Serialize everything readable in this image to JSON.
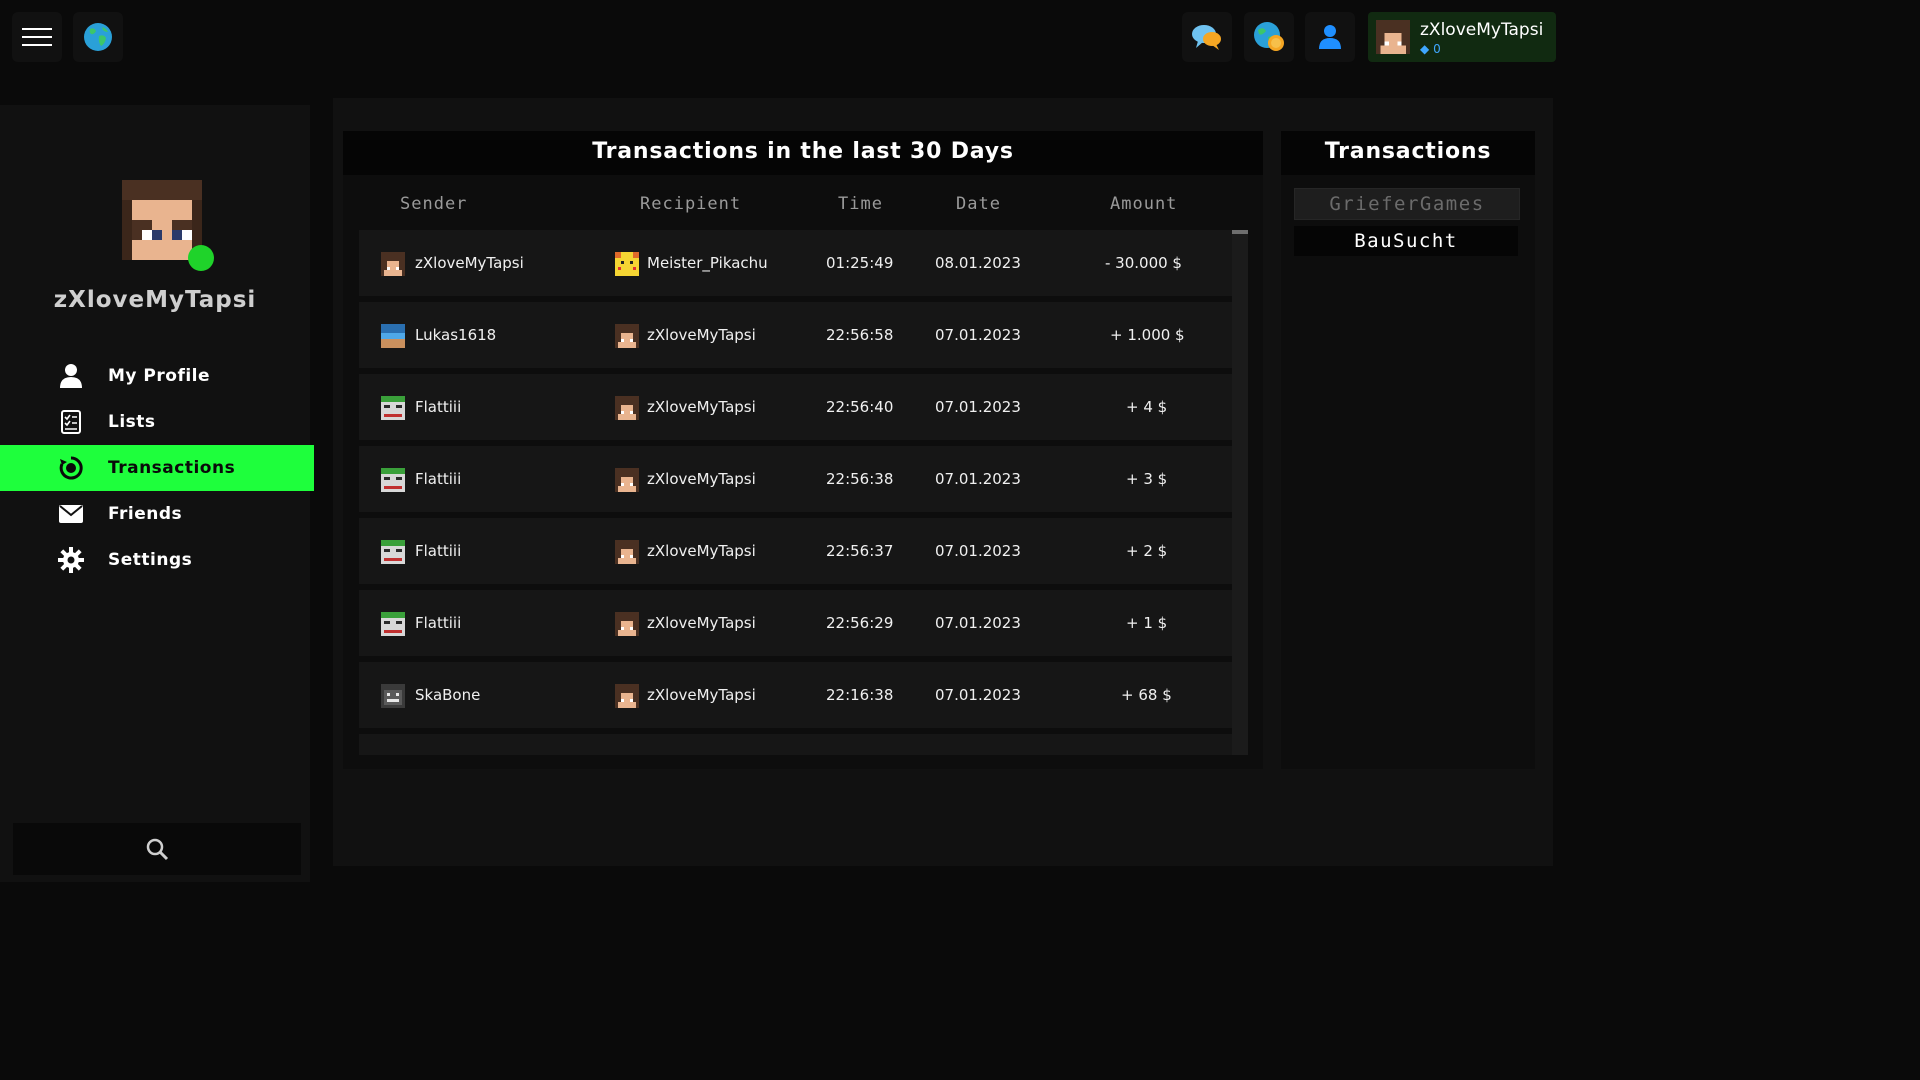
{
  "header": {
    "user_name": "zXloveMyTapsi",
    "gems": "0",
    "icons": [
      "menu-icon",
      "globe-icon",
      "chat-icon",
      "coins-icon",
      "user-icon"
    ]
  },
  "sidebar": {
    "user_name": "zXloveMyTapsi",
    "status": "online",
    "items": [
      {
        "label": "My Profile",
        "icon": "user-icon"
      },
      {
        "label": "Lists",
        "icon": "list-icon"
      },
      {
        "label": "Transactions",
        "icon": "transactions-icon",
        "active": true
      },
      {
        "label": "Friends",
        "icon": "mail-icon"
      },
      {
        "label": "Settings",
        "icon": "gear-icon"
      }
    ],
    "search_icon": "search-icon"
  },
  "transactions": {
    "title": "Transactions in the last 30 Days",
    "columns": {
      "sender": "Sender",
      "recipient": "Recipient",
      "time": "Time",
      "date": "Date",
      "amount": "Amount"
    },
    "rows": [
      {
        "sender": "zXloveMyTapsi",
        "recipient": "Meister_Pikachu",
        "time": "01:25:49",
        "date": "08.01.2023",
        "amount": "- 30.000 $",
        "sign": "negative"
      },
      {
        "sender": "Lukas1618",
        "recipient": "zXloveMyTapsi",
        "time": "22:56:58",
        "date": "07.01.2023",
        "amount": "+ 1.000 $",
        "sign": "positive"
      },
      {
        "sender": "Flattiii",
        "recipient": "zXloveMyTapsi",
        "time": "22:56:40",
        "date": "07.01.2023",
        "amount": "+ 4 $",
        "sign": "positive"
      },
      {
        "sender": "Flattiii",
        "recipient": "zXloveMyTapsi",
        "time": "22:56:38",
        "date": "07.01.2023",
        "amount": "+ 3 $",
        "sign": "positive"
      },
      {
        "sender": "Flattiii",
        "recipient": "zXloveMyTapsi",
        "time": "22:56:37",
        "date": "07.01.2023",
        "amount": "+ 2 $",
        "sign": "positive"
      },
      {
        "sender": "Flattiii",
        "recipient": "zXloveMyTapsi",
        "time": "22:56:29",
        "date": "07.01.2023",
        "amount": "+ 1 $",
        "sign": "positive"
      },
      {
        "sender": "SkaBone",
        "recipient": "zXloveMyTapsi",
        "time": "22:16:38",
        "date": "07.01.2023",
        "amount": "+ 68 $",
        "sign": "positive"
      }
    ]
  },
  "servers": {
    "title": "Transactions",
    "items": [
      {
        "label": "GrieferGames",
        "selected": true
      },
      {
        "label": "BauSucht",
        "selected": false
      }
    ]
  },
  "colors": {
    "accent": "#1eff3c",
    "negative": "#e02a2a",
    "positive": "#39e05a",
    "background": "#0a0a0a"
  }
}
